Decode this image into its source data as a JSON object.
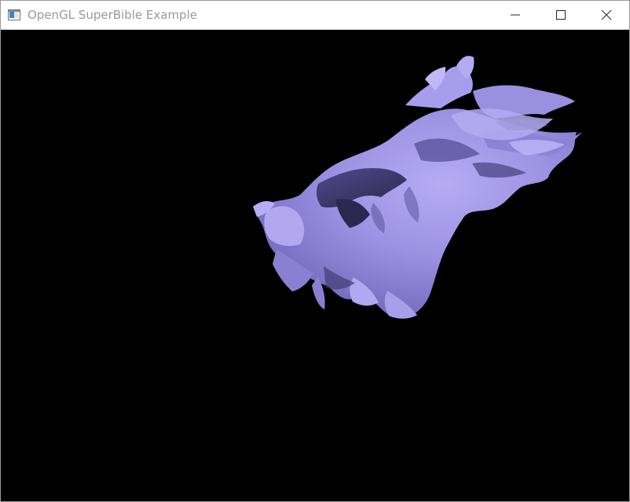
{
  "window": {
    "title": "OpenGL SuperBible Example",
    "controls": {
      "minimize_icon": "minimize-icon",
      "maximize_icon": "maximize-icon",
      "close_icon": "close-icon"
    }
  },
  "scene": {
    "background": "#000000",
    "model_color": "#9f93e6",
    "model": "dragon"
  }
}
